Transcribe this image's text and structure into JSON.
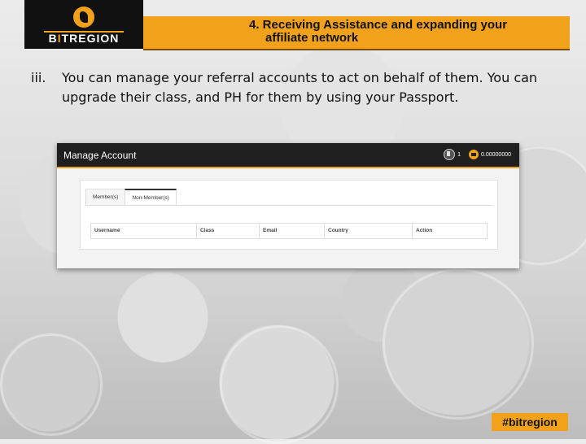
{
  "header": {
    "logo_text_prefix": "B",
    "logo_text_accent": "I",
    "logo_text_rest": "TREGION",
    "title_line1": "4. Receiving Assistance and expanding your",
    "title_line2": "affiliate network"
  },
  "bullet": {
    "number": "iii.",
    "text": "You can manage your referral accounts to act on behalf of them. You can upgrade their class, and PH for them by using your Passport."
  },
  "screenshot": {
    "page_title": "Manage Account",
    "passport_count": "1",
    "wallet_balance": "0.00000000",
    "tabs": [
      {
        "label": "Member(s)"
      },
      {
        "label": "Non-Member(s)"
      }
    ],
    "columns": [
      "Username",
      "Class",
      "Email",
      "Country",
      "Action"
    ]
  },
  "footer": {
    "hashtag": "#bitregion"
  },
  "colors": {
    "accent": "#f1a21a",
    "dark": "#111111"
  }
}
